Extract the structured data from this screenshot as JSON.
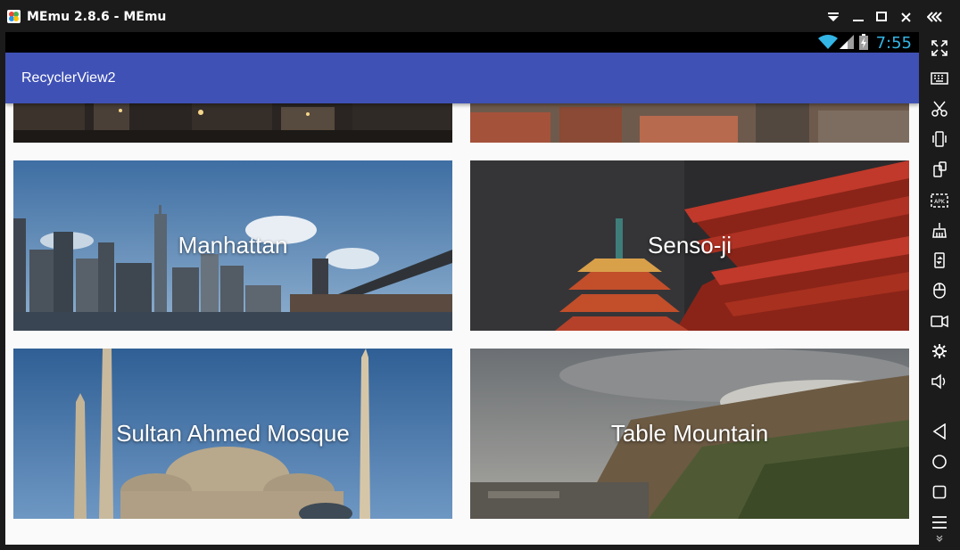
{
  "window": {
    "title": "MEmu 2.8.6 - MEmu"
  },
  "statusbar": {
    "time": "7:55"
  },
  "app": {
    "title": "RecyclerView2"
  },
  "cards": [
    {
      "label": "",
      "scene": "city-night"
    },
    {
      "label": "",
      "scene": "rooftops"
    },
    {
      "label": "Manhattan",
      "scene": "manhattan"
    },
    {
      "label": "Senso-ji",
      "scene": "sensoji"
    },
    {
      "label": "Sultan Ahmed Mosque",
      "scene": "mosque"
    },
    {
      "label": "Table Mountain",
      "scene": "table-mountain"
    }
  ],
  "sidebar": {
    "items": [
      "fullscreen-icon",
      "keyboard-icon",
      "scissors-icon",
      "vibrate-icon",
      "rotate-icon",
      "apk-icon",
      "shovel-icon",
      "transfer-icon",
      "mouse-icon",
      "record-icon",
      "settings-icon",
      "volume-icon",
      "back-icon",
      "home-icon",
      "recents-icon",
      "menu-icon"
    ]
  },
  "colors": {
    "toolbar": "#3f51b5",
    "chrome": "#1b1b1b",
    "clock": "#33b5e5"
  }
}
